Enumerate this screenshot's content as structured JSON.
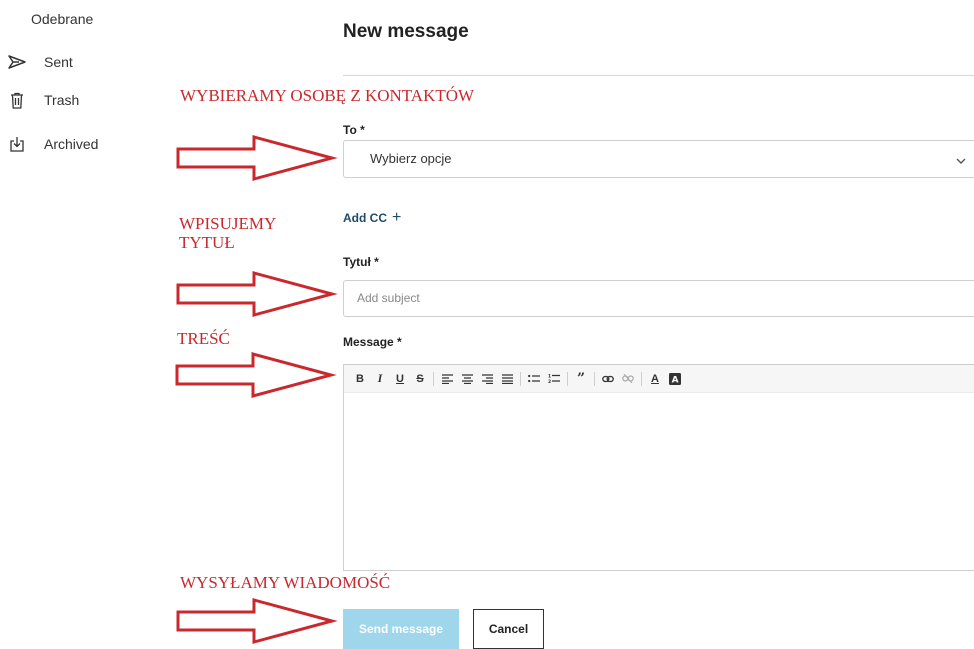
{
  "sidebar": {
    "top_item": "Odebrane",
    "items": [
      {
        "label": "Sent",
        "icon": "send-icon"
      },
      {
        "label": "Trash",
        "icon": "trash-icon"
      },
      {
        "label": "Archived",
        "icon": "archive-icon"
      }
    ]
  },
  "form": {
    "title": "New message",
    "to_label": "To *",
    "to_value": "Wybierz opcje",
    "add_cc": "Add CC",
    "subject_label": "Tytuł *",
    "subject_placeholder": "Add subject",
    "message_label": "Message *",
    "send_label": "Send message",
    "cancel_label": "Cancel"
  },
  "annotations": {
    "contacts": "WYBIERAMY OSOBĘ Z KONTAKTÓW",
    "title_line1": "WPISUJEMY",
    "title_line2": "TYTUŁ",
    "content": "TREŚĆ",
    "send": "WYSYŁAMY WIADOMOŚĆ"
  },
  "colors": {
    "annotation": "#c9282d",
    "send_button": "#9fd6ec",
    "link": "#1e4a6e"
  }
}
